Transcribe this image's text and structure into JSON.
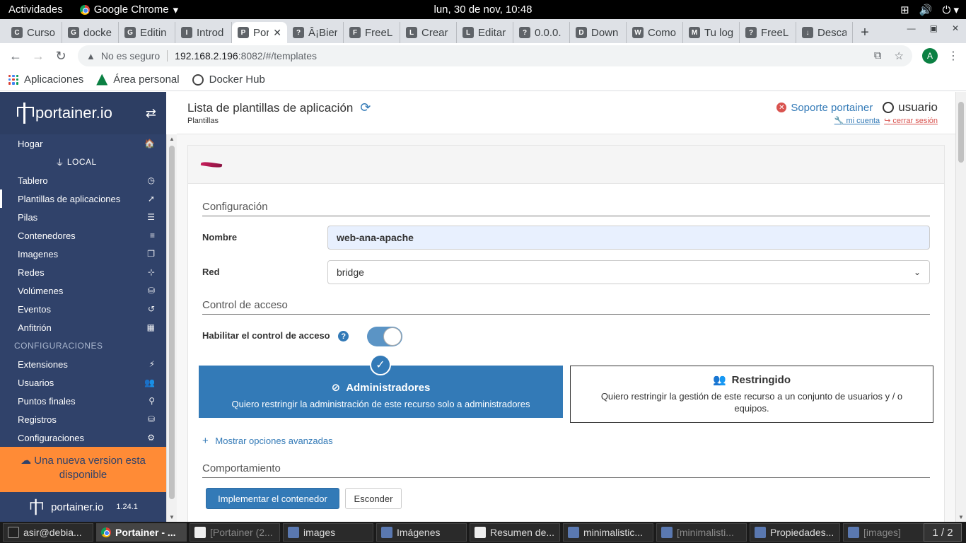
{
  "system_bar": {
    "activities": "Actividades",
    "app_name": "Google Chrome",
    "clock": "lun, 30 de nov, 10:48"
  },
  "tabs": [
    {
      "label": "Curso",
      "icon": "C"
    },
    {
      "label": "docke",
      "icon": "G"
    },
    {
      "label": "Editin",
      "icon": "G"
    },
    {
      "label": "Introd",
      "icon": "I"
    },
    {
      "label": "Por",
      "icon": "P",
      "active": true
    },
    {
      "label": "Â¡Bier",
      "icon": "?"
    },
    {
      "label": "FreeL",
      "icon": "F"
    },
    {
      "label": "Crear",
      "icon": "L"
    },
    {
      "label": "Editar",
      "icon": "L"
    },
    {
      "label": "0.0.0.",
      "icon": "?"
    },
    {
      "label": "Down",
      "icon": "D"
    },
    {
      "label": "Como",
      "icon": "W"
    },
    {
      "label": "Tu log",
      "icon": "M"
    },
    {
      "label": "FreeL",
      "icon": "?"
    },
    {
      "label": "Desca",
      "icon": "↓"
    }
  ],
  "address_bar": {
    "security": "No es seguro",
    "host": "192.168.2.196",
    "path": ":8082/#/templates",
    "avatar_letter": "A"
  },
  "bookmarks": [
    "Aplicaciones",
    "Área personal",
    "Docker Hub"
  ],
  "sidebar": {
    "logo_text": "portainer.io",
    "items_top": [
      {
        "label": "Hogar",
        "icon": "🏠"
      }
    ],
    "endpoint_title": "LOCAL",
    "items": [
      {
        "label": "Tablero",
        "icon": "◷"
      },
      {
        "label": "Plantillas de aplicaciones",
        "icon": "➚",
        "active": true
      },
      {
        "label": "Pilas",
        "icon": "☰"
      },
      {
        "label": "Contenedores",
        "icon": "≡"
      },
      {
        "label": "Imagenes",
        "icon": "❐"
      },
      {
        "label": "Redes",
        "icon": "⊹"
      },
      {
        "label": "Volúmenes",
        "icon": "⛁"
      },
      {
        "label": "Eventos",
        "icon": "↺"
      },
      {
        "label": "Anfitrión",
        "icon": "▦"
      }
    ],
    "config_section": "CONFIGURACIONES",
    "config_items": [
      {
        "label": "Extensiones",
        "icon": "⚡"
      },
      {
        "label": "Usuarios",
        "icon": "👥"
      },
      {
        "label": "Puntos finales",
        "icon": "⚲"
      },
      {
        "label": "Registros",
        "icon": "⛁"
      },
      {
        "label": "Configuraciones",
        "icon": "⚙"
      }
    ],
    "update_notice": "Una nueva version esta disponible",
    "footer_logo": "portainer.io",
    "version": "1.24.1"
  },
  "header": {
    "title": "Lista de plantillas de aplicación",
    "breadcrumb": "Plantillas",
    "support": "Soporte portainer",
    "username": "usuario",
    "my_account": "mi cuenta",
    "logout": "cerrar sesión"
  },
  "form": {
    "config_title": "Configuración",
    "name_label": "Nombre",
    "name_value": "web-ana-apache",
    "network_label": "Red",
    "network_value": "bridge",
    "access_title": "Control de acceso",
    "access_toggle_label": "Habilitar el control de acceso",
    "access_enabled": true,
    "admin_option": {
      "title": "Administradores",
      "description": "Quiero restringir la administración de este recurso solo a administradores",
      "selected": true
    },
    "restricted_option": {
      "title": "Restringido",
      "description": "Quiero restringir la gestión de este recurso a un conjunto de usuarios y / o equipos."
    },
    "advanced_link": "Mostrar opciones avanzadas",
    "behaviour_title": "Comportamiento",
    "deploy_button": "Implementar el contenedor",
    "hide_button": "Esconder"
  },
  "taskbar": {
    "tasks": [
      {
        "label": "asir@debia...",
        "icon": "term"
      },
      {
        "label": "Portainer - ...",
        "icon": "chrome",
        "active": true
      },
      {
        "label": "[Portainer (2...",
        "icon": "doc",
        "dim": true
      },
      {
        "label": "images",
        "icon": "folder"
      },
      {
        "label": "Imágenes",
        "icon": "folder"
      },
      {
        "label": "Resumen de...",
        "icon": "doc"
      },
      {
        "label": "minimalistic...",
        "icon": "app"
      },
      {
        "label": "[minimalisti...",
        "icon": "folder",
        "dim": true
      },
      {
        "label": "Propiedades...",
        "icon": "folder"
      },
      {
        "label": "[images]",
        "icon": "folder",
        "dim": true
      }
    ],
    "pager": "1 / 2"
  },
  "colors": {
    "sidebar_bg": "#30426a",
    "accent": "#337ab7",
    "update_banner": "#ff8b36",
    "danger": "#d9534f"
  }
}
